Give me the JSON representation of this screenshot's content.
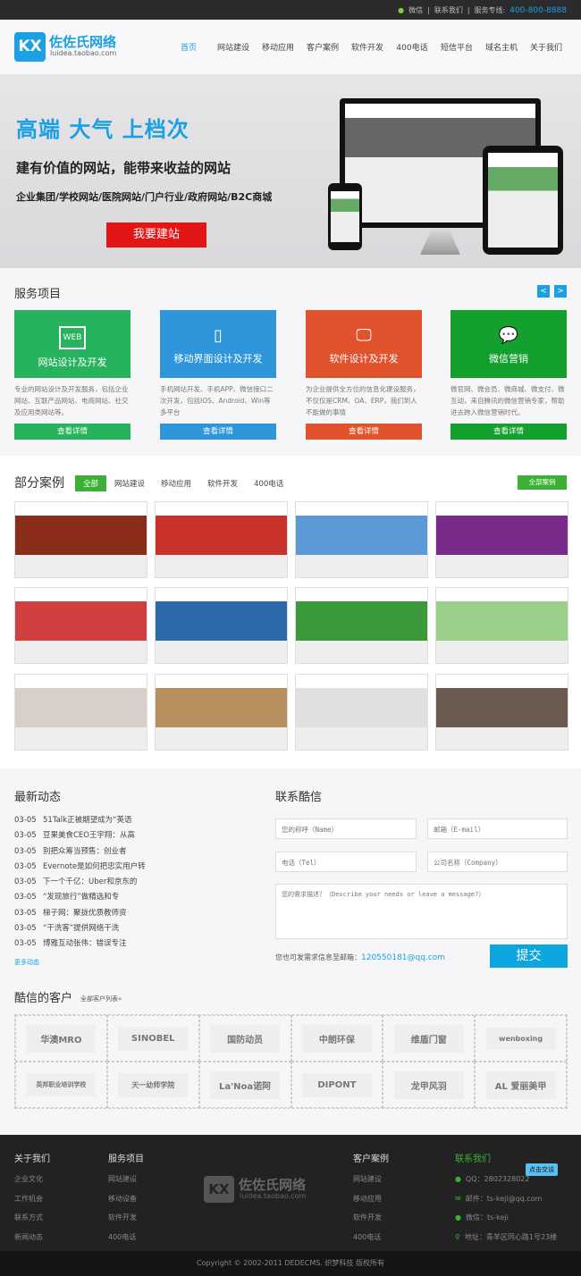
{
  "topbar": {
    "wechat": "微信",
    "contact": "联系我们",
    "hotline_label": "服务专线:",
    "hotline": "400-800-8888"
  },
  "logo": {
    "mark": "KX",
    "name": "佐佐氏网络",
    "sub": "luidea.taobao.com"
  },
  "nav": [
    "首页",
    "网站建设",
    "移动应用",
    "客户案例",
    "软件开发",
    "400电话",
    "短信平台",
    "域名主机",
    "关于我们"
  ],
  "hero": {
    "title": "高端 大气 上档次",
    "subtitle": "建有价值的网站，能带来收益的网站",
    "types": "企业集团/学校网站/医院网站/门户行业/政府网站/B2C商城",
    "button": "我要建站"
  },
  "services": {
    "title": "服务项目",
    "prev": "<",
    "next": ">",
    "items": [
      {
        "icon": "WEB",
        "title": "网站设计及开发",
        "desc": "专业的网站设计及开发服务，包括企业网站、互联产品网站、电商网站、社交及应用类网站等。",
        "button": "查看详情",
        "color": "#27b35d"
      },
      {
        "icon": "▯",
        "title": "移动界面设计及开发",
        "desc": "手机网站开发、手机APP、微信接口二次开发，包括IOS、Android、Win等多平台",
        "button": "查看详情",
        "color": "#2f96db"
      },
      {
        "icon": "🖵",
        "title": "软件设计及开发",
        "desc": "为企业提供全方位的信息化建设服务，不仅仅是CRM、OA、ERP，我们到人不能做的事情",
        "button": "查看详情",
        "color": "#e0532c"
      },
      {
        "icon": "💬",
        "title": "微信营销",
        "desc": "微官网、微会员、微商城、微支付、微互动，来自腾讯的微信营销专家，帮助进去跨入微信营销时代。",
        "button": "查看详情",
        "color": "#14a02e"
      }
    ]
  },
  "cases": {
    "title": "部分案例",
    "filters": [
      "全部",
      "网站建设",
      "移动应用",
      "软件开发",
      "400电话"
    ],
    "all_button": "全部案例",
    "thumbs": [
      "#8a2d1a",
      "#c8322a",
      "#5a9ad6",
      "#7a2a8a",
      "#d04040",
      "#2a6aa8",
      "#3a9a3a",
      "#9ad08a",
      "#d8d0c8",
      "#b89060",
      "#e0e0e0",
      "#6a5a50"
    ]
  },
  "news": {
    "title": "最新动态",
    "items": [
      {
        "date": "03-05",
        "text": "51Talk正被期望成为“英语"
      },
      {
        "date": "03-05",
        "text": "豆果美食CEO王宇翔：从高"
      },
      {
        "date": "03-05",
        "text": "别把众筹当预售：创业者"
      },
      {
        "date": "03-05",
        "text": "Evernote是如何把忠实用户转"
      },
      {
        "date": "03-05",
        "text": "下一个千亿：Uber和京东的"
      },
      {
        "date": "03-05",
        "text": "“发现旅行”做精选和专"
      },
      {
        "date": "03-05",
        "text": "梯子网：聚拢优质教师资"
      },
      {
        "date": "03-05",
        "text": "“干洗客”提供网络干洗"
      },
      {
        "date": "03-05",
        "text": "博雅互动张伟：错误专注"
      }
    ],
    "more": "更多动态"
  },
  "contact": {
    "title": "联系酷信",
    "name": "您的称呼（Name）",
    "email": "邮箱（E-mail）",
    "tel": "电话（Tel）",
    "company": "公司名称（Company）",
    "message": "您的需求描述？（Describe your needs or leave a message?）",
    "note": "您也可发需求信息至邮箱：",
    "note_email": "120550181@qq.com",
    "submit": "提交"
  },
  "clients": {
    "title": "酷信的客户",
    "link": "全部客户列表»",
    "items": [
      "华澳MRO",
      "SINOBEL",
      "国防动员",
      "中朗环保",
      "维盾门窗",
      "wenboxing",
      "英邦职业培训学校",
      "天一幼师学院",
      "La'Noa诺阿",
      "DIPONT",
      "龙甲风羽",
      "AL 爱丽美甲"
    ]
  },
  "footer": {
    "cols": [
      {
        "title": "关于我们",
        "items": [
          "企业文化",
          "工作机会",
          "联系方式",
          "新闻动态"
        ]
      },
      {
        "title": "服务项目",
        "items": [
          "网站建设",
          "移动设备",
          "软件开发",
          "400电话"
        ]
      },
      {
        "title": "客户案例",
        "items": [
          "网站建设",
          "移动应用",
          "软件开发",
          "400电话"
        ]
      }
    ],
    "contact_title": "联系我们",
    "chat": "点击交谈",
    "qq": "QQ：2802328022",
    "mail": "邮件：ts-keji@qq.com",
    "wechat": "微信：ts-keji",
    "address": "地址：青羊区同心路1号23楼",
    "logo_name": "佐佐氏网络",
    "logo_sub": "luidea.taobao.com",
    "logo_mark": "KX"
  },
  "copyright": "Copyright © 2002-2011 DEDECMS. 织梦科技 版权所有"
}
